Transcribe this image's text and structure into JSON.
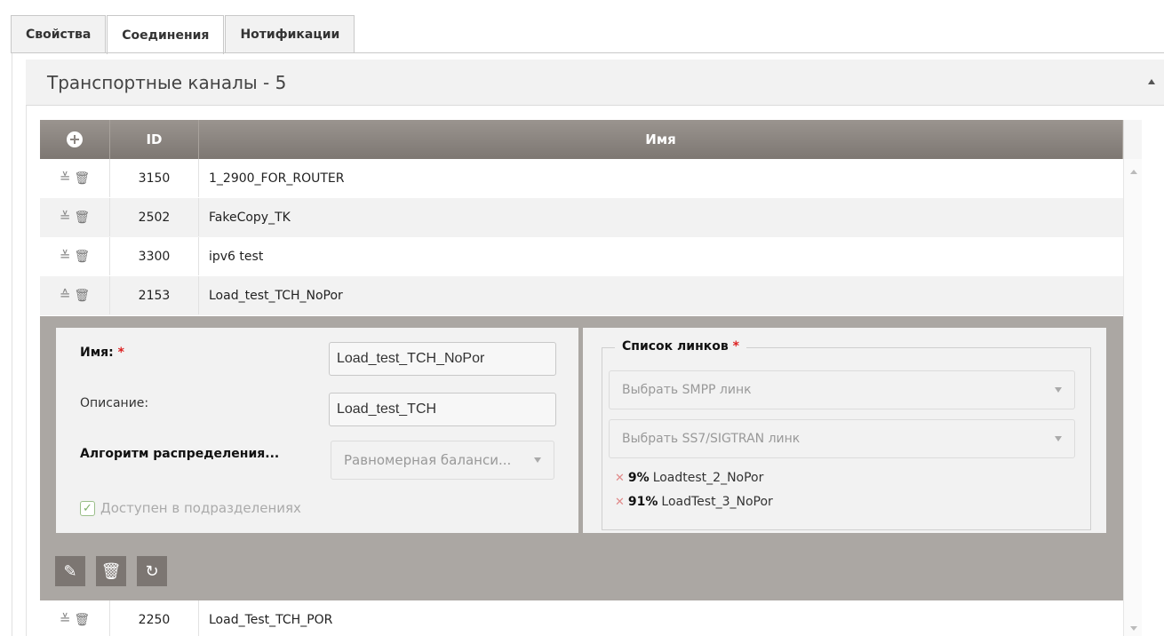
{
  "tabs": [
    {
      "label": "Свойства",
      "active": false
    },
    {
      "label": "Соединения",
      "active": true
    },
    {
      "label": "Нотификации",
      "active": false
    }
  ],
  "panel": {
    "title": "Транспортные каналы - 5"
  },
  "table": {
    "headers": {
      "id": "ID",
      "name": "Имя"
    },
    "rows": [
      {
        "id": "3150",
        "name": "1_2900_FOR_ROUTER",
        "expanded": false
      },
      {
        "id": "2502",
        "name": "FakeCopy_TK",
        "expanded": false
      },
      {
        "id": "3300",
        "name": "ipv6 test",
        "expanded": false
      },
      {
        "id": "2153",
        "name": "Load_test_TCH_NoPor",
        "expanded": true
      },
      {
        "id": "2250",
        "name": "Load_Test_TCH_POR",
        "expanded": false
      }
    ]
  },
  "detail": {
    "name_label": "Имя:",
    "name_value": "Load_test_TCH_NoPor",
    "desc_label": "Описание:",
    "desc_value": "Load_test_TCH",
    "algo_label": "Алгоритм распределения...",
    "algo_value": "Равномерная баланси...",
    "available_label": "Доступен в подразделениях",
    "required_mark": "*",
    "links": {
      "legend": "Список линков",
      "smpp_placeholder": "Выбрать SMPP линк",
      "ss7_placeholder": "Выбрать SS7/SIGTRAN линк",
      "items": [
        {
          "percent": "9%",
          "name": "Loadtest_2_NoPor"
        },
        {
          "percent": "91%",
          "name": "LoadTest_3_NoPor"
        }
      ]
    }
  },
  "icons": {
    "add": "add-icon",
    "expand": "chevron-down-icon",
    "collapse": "chevron-up-icon",
    "delete": "trash-icon",
    "edit": "edit-icon",
    "reset": "undo-icon"
  },
  "colors": {
    "header_bg": "#8c8681",
    "detail_bg": "#aba7a3",
    "required": "#dd2222"
  }
}
